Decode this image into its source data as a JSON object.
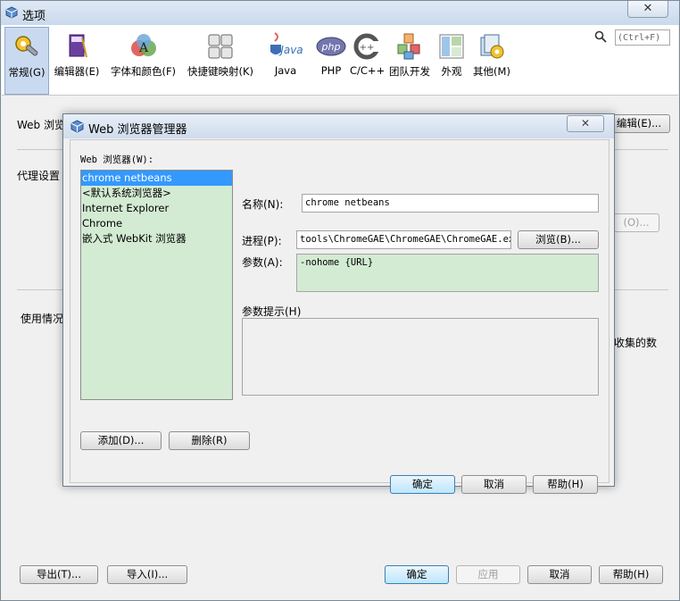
{
  "window": {
    "title": "选项",
    "close_glyph": "✕"
  },
  "toolbar": {
    "categories": [
      {
        "label": "常规(G)",
        "icon": "gear-wrench-icon"
      },
      {
        "label": "编辑器(E)",
        "icon": "editor-book-icon"
      },
      {
        "label": "字体和颜色(F)",
        "icon": "font-color-icon"
      },
      {
        "label": "快捷键映射(K)",
        "icon": "keyboard-icon"
      },
      {
        "label": "Java",
        "icon": "java-icon"
      },
      {
        "label": "PHP",
        "icon": "php-icon"
      },
      {
        "label": "C/C++",
        "icon": "cpp-icon"
      },
      {
        "label": "团队开发",
        "icon": "team-blocks-icon"
      },
      {
        "label": "外观",
        "icon": "appearance-icon"
      },
      {
        "label": "其他(M)",
        "icon": "misc-icon"
      }
    ],
    "active_index": 0,
    "search_placeholder": "(Ctrl+F)"
  },
  "background": {
    "web_browser_label": "Web 浏览器",
    "proxy_label": "代理设置",
    "usage_label": "使用情况",
    "edit_button": "编辑(E)...",
    "ghost_button": "(O)...",
    "collected_text": "收集的数",
    "footer": {
      "export_button": "导出(T)...",
      "import_button": "导入(I)...",
      "ok_button": "确定",
      "apply_button": "应用",
      "cancel_button": "取消",
      "help_button": "帮助(H)"
    }
  },
  "dialog": {
    "title": "Web 浏览器管理器",
    "close_glyph": "✕",
    "browsers_label": "Web 浏览器(W):",
    "browsers": [
      {
        "name": "chrome netbeans",
        "selected": true
      },
      {
        "name": "<默认系统浏览器>",
        "selected": false
      },
      {
        "name": "Internet Explorer",
        "selected": false
      },
      {
        "name": "Chrome",
        "selected": false
      },
      {
        "name": "嵌入式 WebKit 浏览器",
        "selected": false
      }
    ],
    "name_label": "名称(N):",
    "name_value": "chrome netbeans",
    "process_label": "进程(P):",
    "process_value": "tools\\ChromeGAE\\ChromeGAE\\ChromeGAE.exe",
    "browse_button": "浏览(B)...",
    "args_label": "参数(A):",
    "args_value": "-nohome {URL}",
    "args_hint_label": "参数提示(H)",
    "args_hint_value": "",
    "add_button": "添加(D)...",
    "delete_button": "删除(R)",
    "ok_button": "确定",
    "cancel_button": "取消",
    "help_button": "帮助(H)",
    "colors": {
      "list_bg": "#d3ebd3",
      "selection": "#3399ff"
    }
  }
}
